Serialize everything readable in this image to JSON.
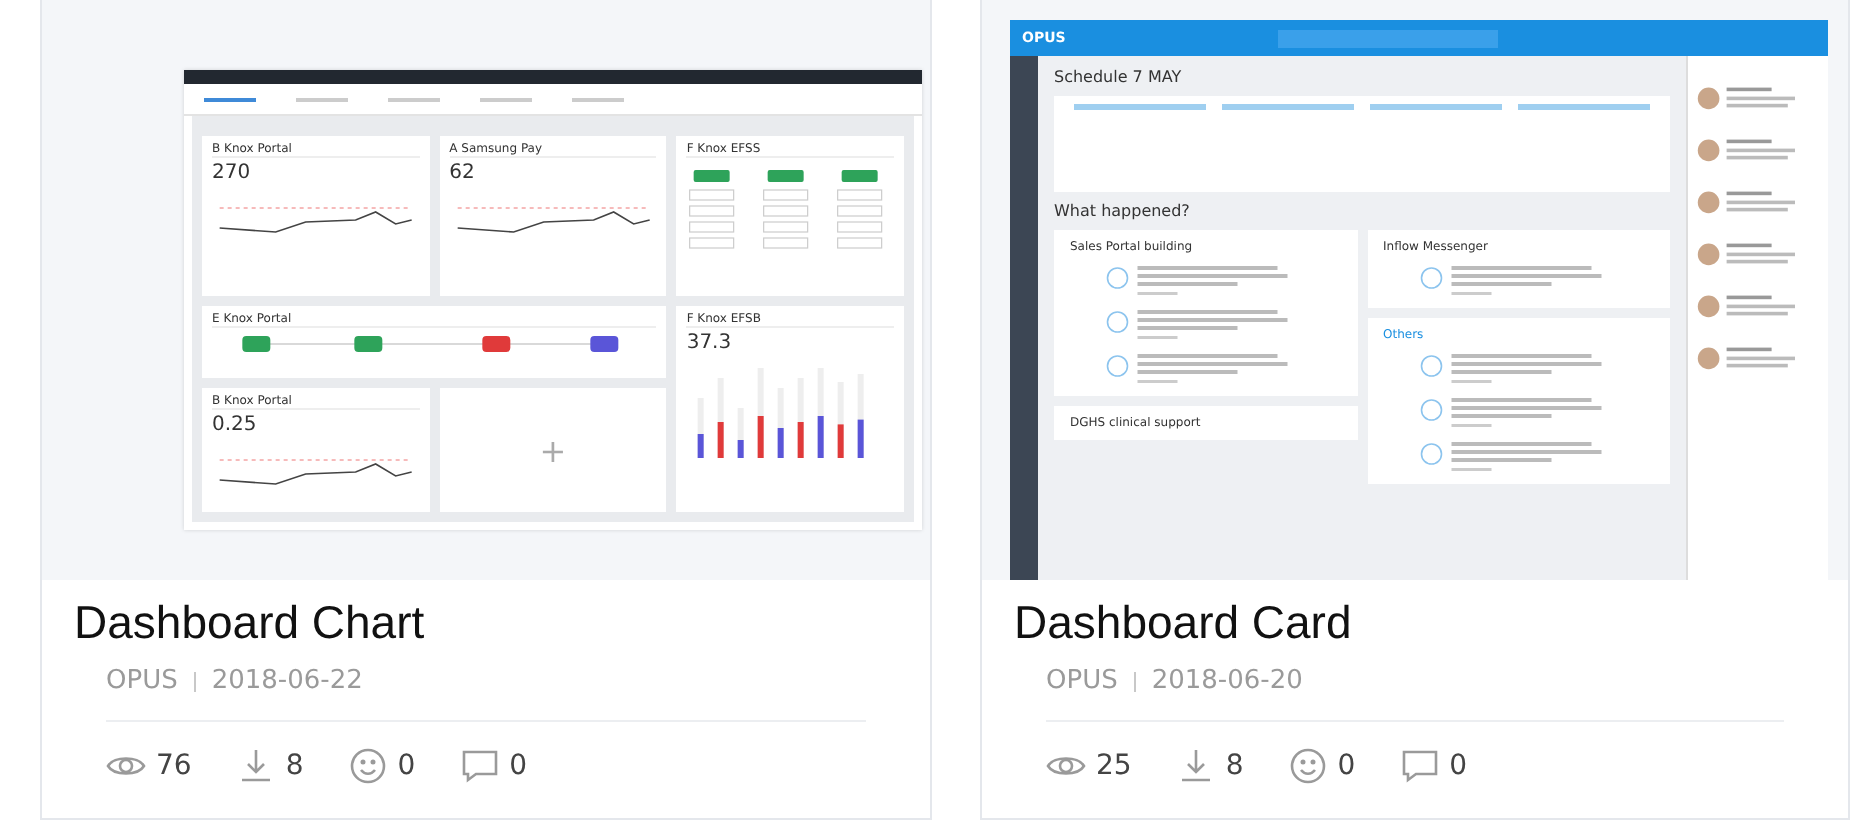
{
  "cards": [
    {
      "title": "Dashboard Chart",
      "source": "OPUS",
      "date": "2018-06-22",
      "stats": [
        {
          "kind": "views",
          "value": "76"
        },
        {
          "kind": "downloads",
          "value": "8"
        },
        {
          "kind": "likes",
          "value": "0"
        },
        {
          "kind": "comments",
          "value": "0"
        }
      ],
      "preview": {
        "kind": "charts",
        "panels": [
          {
            "kind": "line",
            "title": "B Knox Portal",
            "value": "270"
          },
          {
            "kind": "line",
            "title": "A Samsung Pay",
            "value": "62"
          },
          {
            "kind": "tags",
            "title": "F Knox EFSS"
          },
          {
            "kind": "flow",
            "title": "E Knox Portal"
          },
          {
            "kind": "bars",
            "title": "F Knox EFSB",
            "value": "37.3"
          },
          {
            "kind": "line",
            "title": "B Knox Portal",
            "value": "0.25"
          },
          {
            "kind": "add",
            "label": "+"
          }
        ]
      }
    },
    {
      "title": "Dashboard Card",
      "source": "OPUS",
      "date": "2018-06-20",
      "stats": [
        {
          "kind": "views",
          "value": "25"
        },
        {
          "kind": "downloads",
          "value": "8"
        },
        {
          "kind": "likes",
          "value": "0"
        },
        {
          "kind": "comments",
          "value": "0"
        }
      ],
      "preview": {
        "kind": "feed",
        "logo": "OPUS",
        "heading": "Schedule 7 MAY",
        "section": "What happened?",
        "groups": [
          {
            "title": "Sales Portal building",
            "items": [
              {
                "kind": "post"
              },
              {
                "kind": "post"
              },
              {
                "kind": "post"
              }
            ],
            "accent": false
          },
          {
            "title": "DGHS clinical support",
            "accent": false
          }
        ],
        "groups_right": [
          {
            "title": "Inflow Messenger",
            "items": [
              {
                "kind": "post"
              }
            ],
            "accent": false
          },
          {
            "title": "Others",
            "items": [
              {
                "kind": "post"
              },
              {
                "kind": "post"
              },
              {
                "kind": "post"
              }
            ],
            "accent": true
          }
        ]
      }
    }
  ]
}
